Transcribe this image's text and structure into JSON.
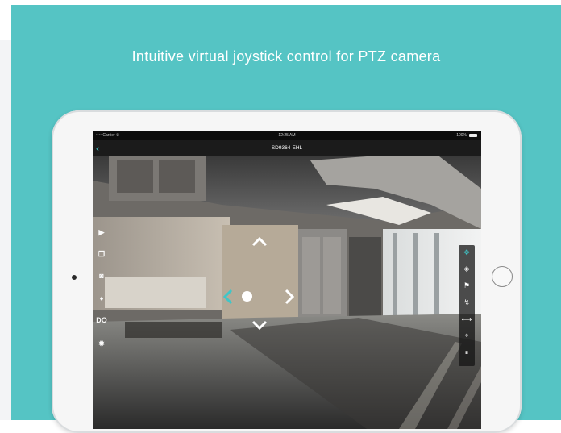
{
  "headline": "Intuitive virtual joystick control for PTZ camera",
  "device": {
    "status_bar": {
      "carrier": "•••• Carrier ✆",
      "time": "12:25 AM",
      "battery": "100%"
    },
    "nav": {
      "back_icon": "chevron-left-icon",
      "title": "SD9364-EHL"
    }
  },
  "left_toolbar": {
    "items": [
      {
        "icon": "playback-icon"
      },
      {
        "icon": "window-icon"
      },
      {
        "icon": "camera-icon"
      },
      {
        "icon": "microphone-icon"
      },
      {
        "icon": "digital-output-icon",
        "label": "DO"
      },
      {
        "icon": "settings-icon"
      }
    ]
  },
  "ptz_panel": {
    "items": [
      {
        "icon": "joystick-move-icon",
        "active": true
      },
      {
        "icon": "target-icon"
      },
      {
        "icon": "flag-icon"
      },
      {
        "icon": "patrol-icon"
      },
      {
        "icon": "auto-pan-icon"
      },
      {
        "icon": "focus-icon"
      },
      {
        "icon": "pause-icon"
      }
    ]
  },
  "joystick": {
    "arrows": [
      "up",
      "down",
      "left",
      "right"
    ],
    "active_direction": "left"
  },
  "colors": {
    "accent": "#3fc6c8",
    "banner": "#55c4c4",
    "bezel": "#f6f6f6"
  }
}
